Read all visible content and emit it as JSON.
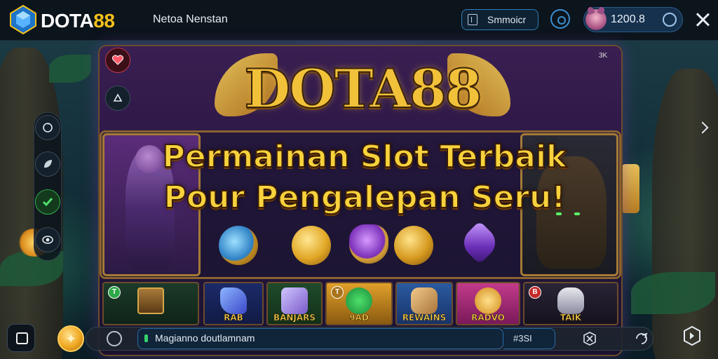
{
  "topbar": {
    "brand_prefix": "DOTA",
    "brand_suffix": "88",
    "nav_title": "Netoa Nenstan",
    "search_label": "Smmoicr",
    "balance": "1200.8"
  },
  "game": {
    "logo_text": "DOTA88",
    "corner_tag": "3K",
    "headline_line1": "Permainan Slot Terbaik",
    "headline_line2": "Pour Pengalepan Seru!",
    "tiles": [
      {
        "label": "RAB",
        "badge": "T",
        "badge_color": "#2fa84a"
      },
      {
        "label": "BANJARS",
        "badge": "",
        "badge_color": ""
      },
      {
        "label": "9AD",
        "badge": "T",
        "badge_color": "#a8741c"
      },
      {
        "label": "REWAINS",
        "badge": "",
        "badge_color": ""
      },
      {
        "label": "RADVO",
        "badge": "",
        "badge_color": ""
      },
      {
        "label": "TAIK",
        "badge": "B",
        "badge_color": "#c42a2a"
      }
    ]
  },
  "bottombar": {
    "input_text": "Magianno doutlamnam",
    "count": "#3SI"
  },
  "colors": {
    "brand_yellow": "#f4c01a",
    "accent_blue": "#2f7fb8",
    "headline_gold": "#f7d23c"
  },
  "icons": [
    "logo-gem-icon",
    "document-icon",
    "settings-icon",
    "avatar-icon",
    "ring-icon",
    "close-icon",
    "heart-icon",
    "recycle-icon",
    "reload-icon",
    "leaf-icon",
    "check-icon",
    "eye-icon",
    "chevron-right-icon",
    "square-icon",
    "coin-icon",
    "cross-icon",
    "tag-icon",
    "shield-icon"
  ]
}
